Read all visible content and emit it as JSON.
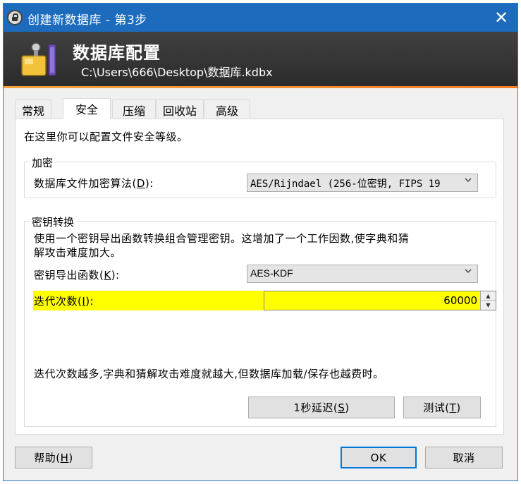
{
  "window": {
    "title": "创建新数据库 - 第3步",
    "close_glyph": "✕"
  },
  "banner": {
    "heading": "数据库配置",
    "path": "C:\\Users\\666\\Desktop\\数据库.kdbx"
  },
  "tabs": [
    {
      "label": "常规",
      "active": false
    },
    {
      "label": "安全",
      "active": true
    },
    {
      "label": "压缩",
      "active": false
    },
    {
      "label": "回收站",
      "active": false
    },
    {
      "label": "高级",
      "active": false
    }
  ],
  "security": {
    "description": "在这里你可以配置文件安全等级。",
    "encryption": {
      "legend": "加密",
      "algorithm_label_pre": "数据库文件加密算法(",
      "algorithm_label_key": "D",
      "algorithm_label_post": "):",
      "algorithm_value": "AES/Rijndael (256-位密钥, FIPS 19"
    },
    "kdf": {
      "legend": "密钥转换",
      "description_line1": "使用一个密钥导出函数转换组合管理密钥。这增加了一个工作因数,使字典和猜",
      "description_line2": "解攻击难度加大。",
      "function_label_pre": "密钥导出函数(",
      "function_label_key": "K",
      "function_label_post": "):",
      "function_value": "AES-KDF",
      "iterations_label_pre": "迭代次数(",
      "iterations_label_key": "I",
      "iterations_label_post": "):",
      "iterations_value": "60000",
      "note": "迭代次数越多,字典和猜解攻击难度就越大,但数据库加载/保存也越费时。",
      "delay_button_pre": "1秒延迟(",
      "delay_button_key": "S",
      "delay_button_post": ")",
      "test_button_pre": "测试(",
      "test_button_key": "T",
      "test_button_post": ")"
    }
  },
  "footer": {
    "help_pre": "帮助(",
    "help_key": "H",
    "help_post": ")",
    "ok": "OK",
    "cancel": "取消"
  },
  "colors": {
    "titlebar": "#1c6bbd",
    "highlight": "#ffff00",
    "banner_accent": "#f77e22"
  },
  "icons": {
    "app": "lock-icon",
    "banner": "database-icon",
    "close": "close-icon",
    "dropdown": "chevron-down-icon",
    "spin_up": "spin-up-icon",
    "spin_down": "spin-down-icon"
  }
}
